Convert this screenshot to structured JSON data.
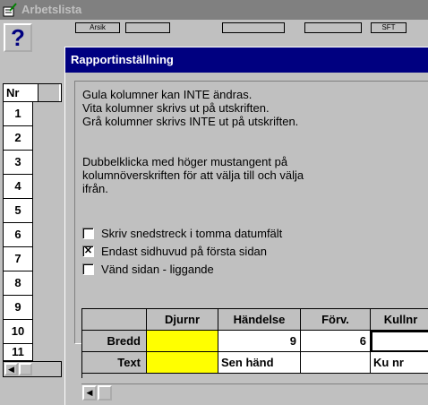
{
  "background_window": {
    "title": "Arbetslista",
    "help_glyph": "?",
    "toolbar_stub_labels": [
      "Arsik",
      "",
      "",
      "",
      "SFT"
    ],
    "nr_header": "Nr",
    "row_numbers": [
      "1",
      "2",
      "3",
      "4",
      "5",
      "6",
      "7",
      "8",
      "9",
      "10",
      "11"
    ]
  },
  "dialog": {
    "title": "Rapportinställning",
    "info_lines": [
      "Gula kolumner kan INTE ändras.",
      "Vita kolumner skrivs ut på utskriften.",
      "Grå kolumner skrivs INTE ut på utskriften.",
      "",
      "Dubbelklicka med höger mustangent på",
      "kolumnöverskriften för att välja till och välja",
      "ifrån."
    ],
    "options": [
      {
        "label": "Skriv snedstreck i tomma datumfält",
        "checked": false,
        "mark": ""
      },
      {
        "label": "Endast sidhuvud på första sidan",
        "checked": true,
        "mark": "✕"
      },
      {
        "label": "Vänd sidan - liggande",
        "checked": false,
        "mark": ""
      }
    ],
    "grid": {
      "columns": [
        "",
        "Djurnr",
        "Händelse",
        "Förv.",
        "Kullnr"
      ],
      "rows": [
        {
          "header": "Bredd",
          "cells": [
            "",
            "9",
            "6",
            ""
          ]
        },
        {
          "header": "Text",
          "cells": [
            "",
            "Sen händ",
            "",
            "Ku nr"
          ]
        }
      ]
    }
  },
  "colors": {
    "title_active": "#000080",
    "title_inactive": "#808080",
    "face": "#c0c0c0",
    "yellow_column": "#ffff00"
  },
  "icons": [
    "list-edit-icon",
    "help-icon",
    "scroll-left-icon"
  ]
}
